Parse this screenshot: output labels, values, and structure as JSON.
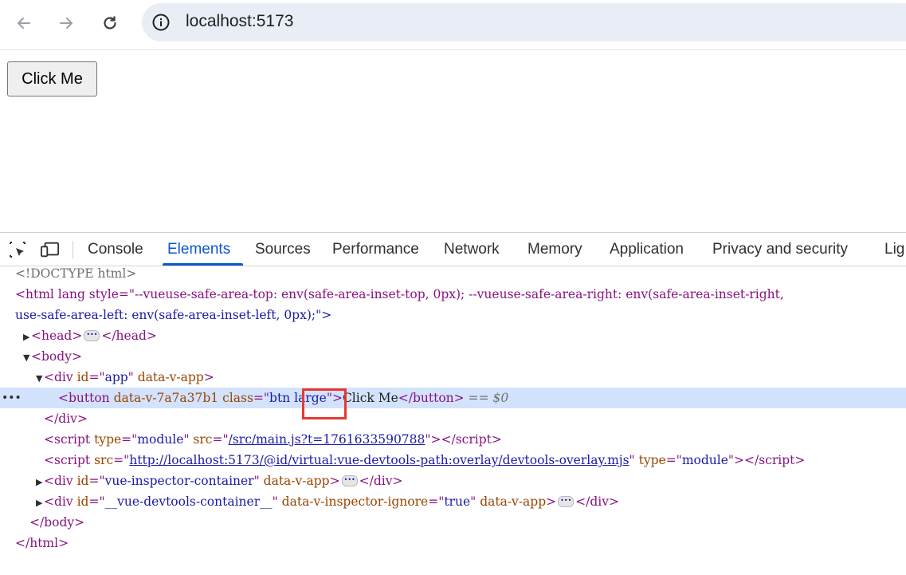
{
  "browser": {
    "url": "localhost:5173"
  },
  "page": {
    "button_label": "Click Me"
  },
  "devtools": {
    "tabs": [
      "Console",
      "Elements",
      "Sources",
      "Performance",
      "Network",
      "Memory",
      "Application",
      "Privacy and security",
      "Lig"
    ],
    "active_tab": "Elements",
    "dom": {
      "doctype": "<!DOCTYPE html>",
      "html_open_1": "<html lang style=\"--vueuse-safe-area-top: env(safe-area-inset-top, 0px); --vueuse-safe-area-right: env(safe-area-inset-right,",
      "html_open_2": "use-safe-area-left: env(safe-area-inset-left, 0px);\">",
      "head": "head",
      "body": "body",
      "div_app_id": "app",
      "div_app_extra": "data-v-app",
      "button_scope": "data-v-7a7a37b1",
      "button_class_a": "btn",
      "button_class_b": "large",
      "button_text": "Click Me",
      "dollar_zero": "== $0",
      "div_close": "</div>",
      "script1_type": "module",
      "script1_src": "/src/main.js?t=1761633590788",
      "script2_src": "http://localhost:5173/@id/virtual:vue-devtools-path:overlay/devtools-overlay.mjs",
      "script2_type": "module",
      "div_inspector_id": "vue-inspector-container",
      "div_devtools_id": "__vue-devtools-container__",
      "div_devtools_ignore": "true",
      "body_close": "</body>",
      "html_close": "</html>"
    }
  },
  "colors": {
    "active_tab": "#0b57d0",
    "selection": "#d3e3fd",
    "highlight_box": "#e53935"
  }
}
